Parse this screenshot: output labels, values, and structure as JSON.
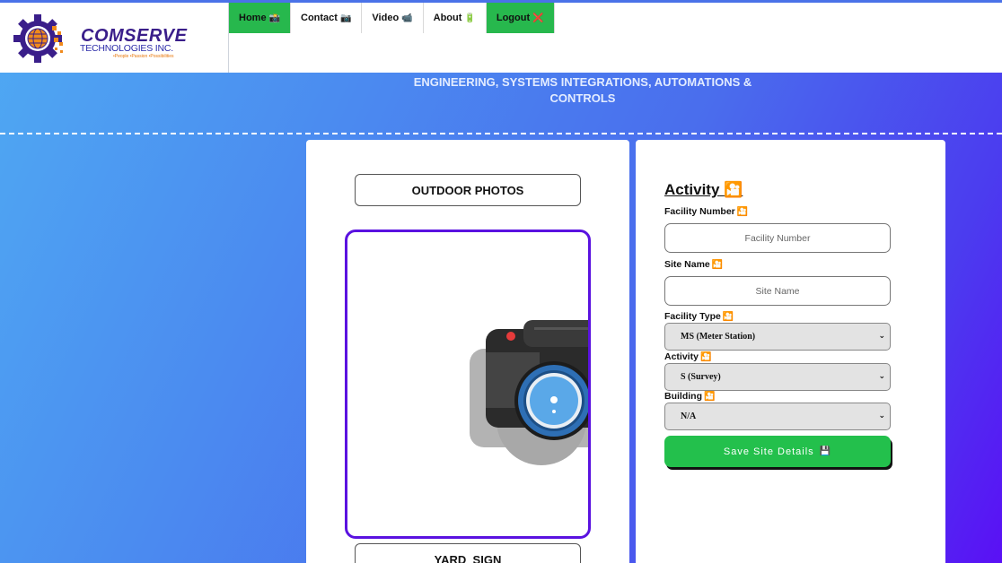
{
  "brand": {
    "name": "COMSERVE",
    "subtitle": "TECHNOLOGIES INC.",
    "tagline": "•People •Passion •Possibilities"
  },
  "nav": [
    {
      "label": "Home",
      "emoji": "📸",
      "active": true
    },
    {
      "label": "Contact",
      "emoji": "📷",
      "active": false
    },
    {
      "label": "Video",
      "emoji": "📹",
      "active": false
    },
    {
      "label": "About",
      "emoji": "🔋",
      "active": false
    },
    {
      "label": "Logout",
      "emoji": "❌",
      "active": true
    }
  ],
  "banner": {
    "line1": "ENGINEERING, SYSTEMS INTEGRATIONS, AUTOMATIONS &",
    "line2": "CONTROLS"
  },
  "photos": {
    "outdoor_label": "OUTDOOR PHOTOS",
    "yard_label": "YARD_SIGN",
    "placeholder_icon": "camera-icon"
  },
  "activity_form": {
    "title": "Activity",
    "title_emoji": "🎦",
    "facility_number": {
      "label": "Facility Number",
      "emoji": "🎦",
      "placeholder": "Facility Number",
      "value": ""
    },
    "site_name": {
      "label": "Site Name",
      "emoji": "🎦",
      "placeholder": "Site Name",
      "value": ""
    },
    "facility_type": {
      "label": "Facility Type",
      "emoji": "🎦",
      "selected": "MS (Meter Station)"
    },
    "activity": {
      "label": "Activity",
      "emoji": "🎦",
      "selected": "S (Survey)"
    },
    "building": {
      "label": "Building",
      "emoji": "🎦",
      "selected": "N/A"
    },
    "save_label": "Save Site Details",
    "save_emoji": "💾"
  },
  "colors": {
    "nav_active": "#27b84d",
    "save_button": "#23c04c",
    "photo_border": "#5a12e0",
    "background_start": "#4fa9f3",
    "background_end": "#5a10f5"
  }
}
